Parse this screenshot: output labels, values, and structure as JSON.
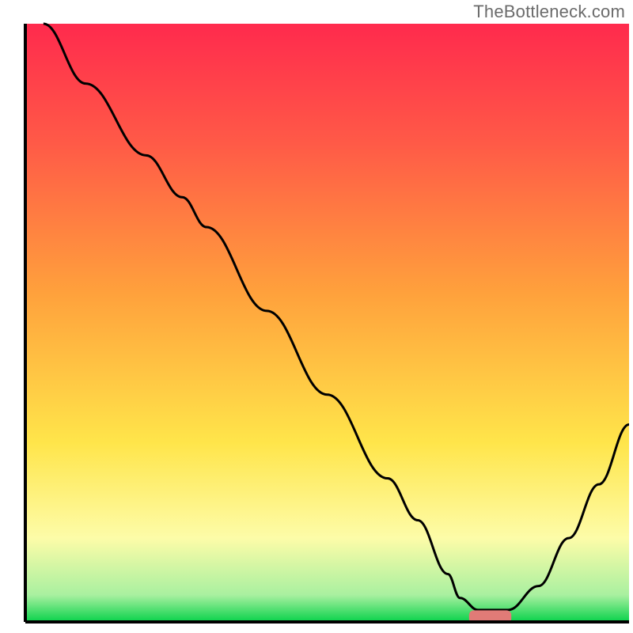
{
  "watermark": "TheBottleneck.com",
  "chart_data": {
    "type": "line",
    "title": "",
    "xlabel": "",
    "ylabel": "",
    "xlim": [
      0,
      100
    ],
    "ylim": [
      0,
      100
    ],
    "background_gradient": {
      "description": "vertical gradient red→orange→yellow→pale-yellow→green, green band at bottom",
      "stops": [
        {
          "offset": 0.0,
          "color": "#ff2a4d"
        },
        {
          "offset": 0.2,
          "color": "#ff5a47"
        },
        {
          "offset": 0.45,
          "color": "#ffa13c"
        },
        {
          "offset": 0.7,
          "color": "#ffe54a"
        },
        {
          "offset": 0.86,
          "color": "#fdfca8"
        },
        {
          "offset": 0.955,
          "color": "#a9f0a0"
        },
        {
          "offset": 1.0,
          "color": "#09d24b"
        }
      ]
    },
    "series": [
      {
        "name": "bottleneck-curve",
        "color": "#000000",
        "x": [
          3,
          10,
          20,
          26,
          30,
          40,
          50,
          60,
          65,
          70,
          72,
          75,
          80,
          85,
          90,
          95,
          100
        ],
        "y": [
          100,
          90,
          78,
          71,
          66,
          52,
          38,
          24,
          17,
          8,
          4,
          2,
          2,
          6,
          14,
          23,
          33
        ]
      }
    ],
    "marker": {
      "name": "optimal-point",
      "shape": "rounded-rect",
      "color": "#e17b77",
      "x": 77,
      "y": 0,
      "width_units": 7,
      "height_units": 2.2
    },
    "axes": {
      "left": true,
      "bottom": true,
      "color": "#000000",
      "ticks": "none"
    }
  }
}
